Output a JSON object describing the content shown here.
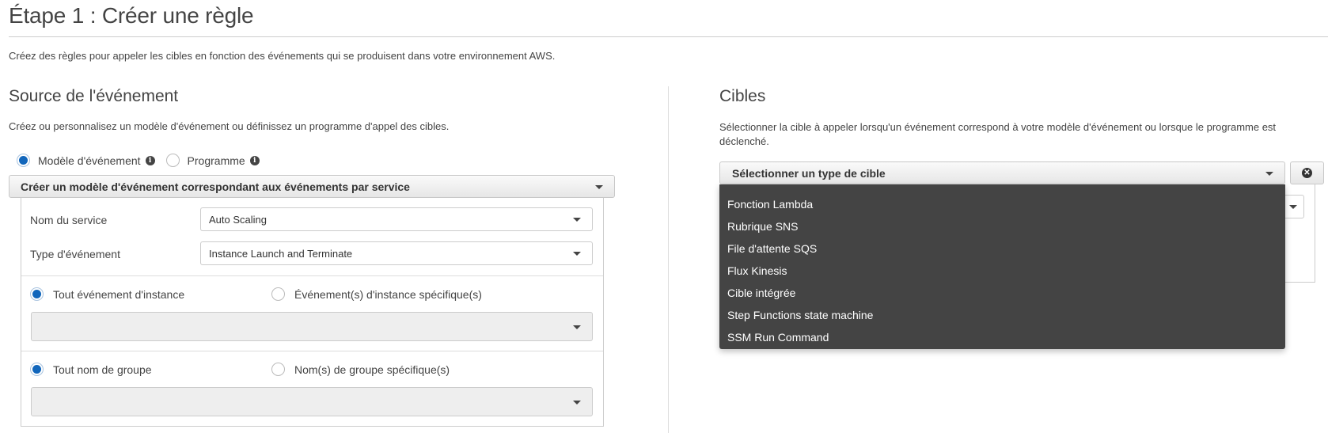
{
  "page": {
    "title": "Étape 1 : Créer une règle",
    "description": "Créez des règles pour appeler les cibles en fonction des événements qui se produisent dans votre environnement AWS."
  },
  "event_source": {
    "title": "Source de l'événement",
    "description": "Créez ou personnalisez un modèle d'événement ou définissez un programme d'appel des cibles.",
    "mode_options": [
      {
        "label": "Modèle d'événement",
        "checked": true,
        "icon": "info-icon"
      },
      {
        "label": "Programme",
        "checked": false,
        "icon": "info-icon"
      }
    ],
    "pattern_dropdown": "Créer un modèle d'événement correspondant aux événements par service",
    "service_name_label": "Nom du service",
    "service_name_value": "Auto Scaling",
    "event_type_label": "Type d'événement",
    "event_type_value": "Instance Launch and Terminate",
    "instance_options": [
      {
        "label": "Tout événement d'instance",
        "checked": true
      },
      {
        "label": "Événement(s) d'instance spécifique(s)",
        "checked": false
      }
    ],
    "instance_select_value": "",
    "group_options": [
      {
        "label": "Tout nom de groupe",
        "checked": true
      },
      {
        "label": "Nom(s) de groupe spécifique(s)",
        "checked": false
      }
    ],
    "group_select_value": ""
  },
  "targets": {
    "title": "Cibles",
    "description": "Sélectionner la cible à appeler lorsqu'un événement correspond à votre modèle d'événement ou lorsque le programme est déclenché.",
    "target_type_dropdown": "Sélectionner un type de cible",
    "remove_icon": "close-icon",
    "menu_items": [
      "Fonction Lambda",
      "Rubrique SNS",
      "File d'attente SQS",
      "Flux Kinesis",
      "Cible intégrée",
      "Step Functions state machine",
      "SSM Run Command"
    ]
  },
  "colors": {
    "accent": "#1166bb",
    "menu_bg": "#444444",
    "text": "#444444"
  }
}
